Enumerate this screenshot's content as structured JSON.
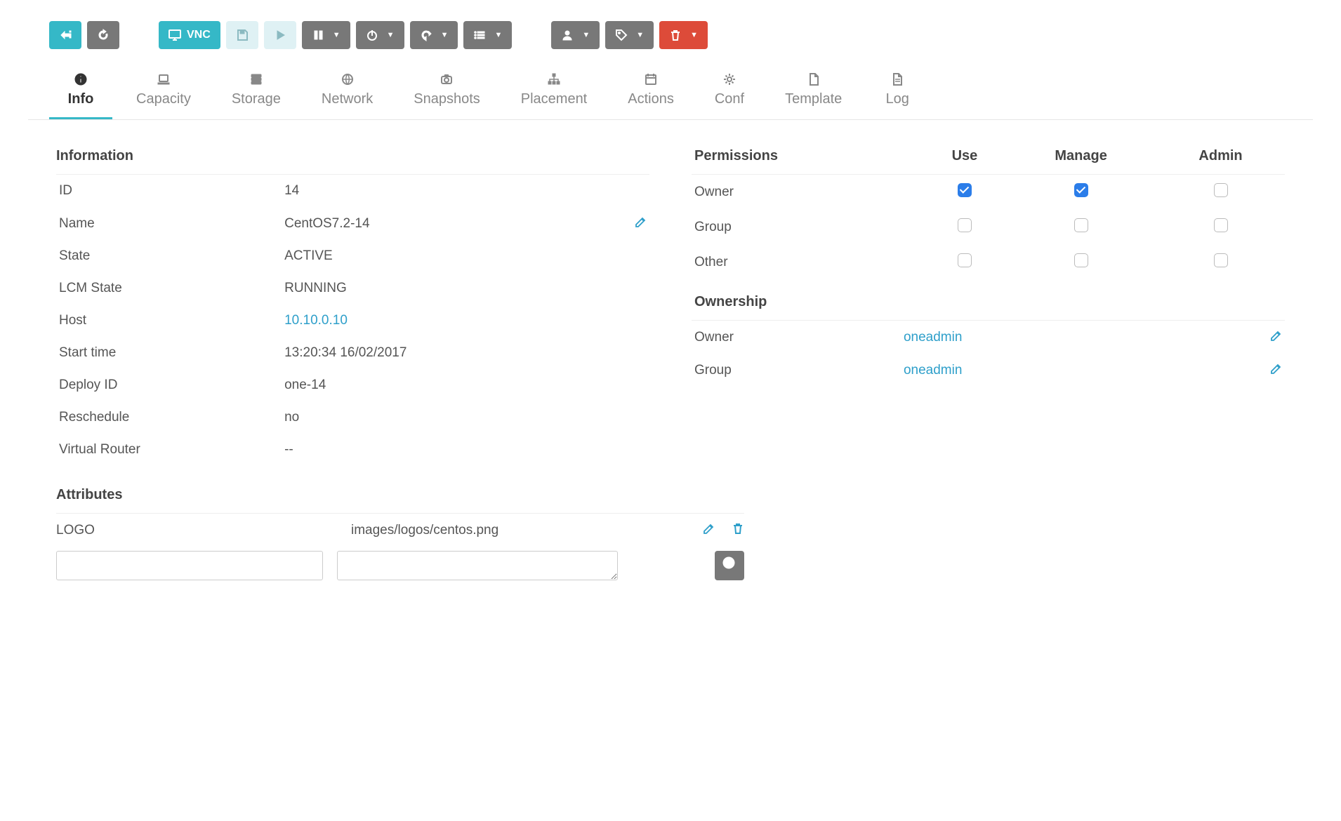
{
  "toolbar": {
    "vnc_label": "VNC"
  },
  "tabs": [
    {
      "label": "Info",
      "icon": "info"
    },
    {
      "label": "Capacity",
      "icon": "laptop"
    },
    {
      "label": "Storage",
      "icon": "server"
    },
    {
      "label": "Network",
      "icon": "globe"
    },
    {
      "label": "Snapshots",
      "icon": "camera"
    },
    {
      "label": "Placement",
      "icon": "sitemap"
    },
    {
      "label": "Actions",
      "icon": "calendar"
    },
    {
      "label": "Conf",
      "icon": "cog"
    },
    {
      "label": "Template",
      "icon": "file"
    },
    {
      "label": "Log",
      "icon": "filetext"
    }
  ],
  "information": {
    "title": "Information",
    "rows": {
      "id_label": "ID",
      "id_value": "14",
      "name_label": "Name",
      "name_value": "CentOS7.2-14",
      "state_label": "State",
      "state_value": "ACTIVE",
      "lcm_label": "LCM State",
      "lcm_value": "RUNNING",
      "host_label": "Host",
      "host_value": "10.10.0.10",
      "start_label": "Start time",
      "start_value": "13:20:34 16/02/2017",
      "deploy_label": "Deploy ID",
      "deploy_value": "one-14",
      "resched_label": "Reschedule",
      "resched_value": "no",
      "vrouter_label": "Virtual Router",
      "vrouter_value": "--"
    }
  },
  "permissions": {
    "title": "Permissions",
    "cols": {
      "use": "Use",
      "manage": "Manage",
      "admin": "Admin"
    },
    "rows": [
      {
        "label": "Owner",
        "use": true,
        "manage": true,
        "admin": false
      },
      {
        "label": "Group",
        "use": false,
        "manage": false,
        "admin": false
      },
      {
        "label": "Other",
        "use": false,
        "manage": false,
        "admin": false
      }
    ]
  },
  "ownership": {
    "title": "Ownership",
    "owner_label": "Owner",
    "owner_value": "oneadmin",
    "group_label": "Group",
    "group_value": "oneadmin"
  },
  "attributes": {
    "title": "Attributes",
    "rows": [
      {
        "key": "LOGO",
        "value": "images/logos/centos.png"
      }
    ],
    "new_key": "",
    "new_value": ""
  }
}
